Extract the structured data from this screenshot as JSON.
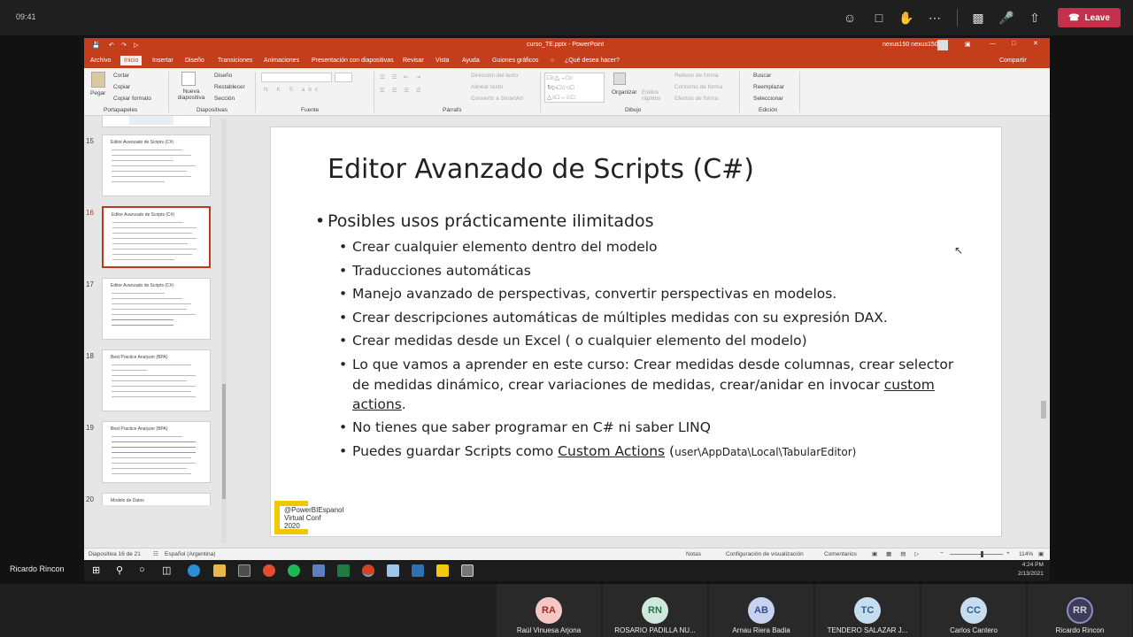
{
  "teams": {
    "time": "09:41",
    "leave_label": "Leave",
    "presenter_name": "Ricardo Rincon"
  },
  "ppt": {
    "window_title": "curso_TE.pptx - PowerPoint",
    "user": "nexus150 nexus150",
    "tabs": [
      "Archivo",
      "Inicio",
      "Insertar",
      "Diseño",
      "Transiciones",
      "Animaciones",
      "Presentación con diapositivas",
      "Revisar",
      "Vista",
      "Ayuda",
      "Guiones gráficos"
    ],
    "tell_me": "¿Qué desea hacer?",
    "share": "Compartir",
    "ribbon": {
      "pegar": "Pegar",
      "cortar": "Cortar",
      "copiar": "Copiar",
      "copiar_formato": "Copiar formato",
      "portapapeles": "Portapapeles",
      "nueva_diapositiva": "Nueva diapositiva",
      "diseno": "Diseño",
      "restablecer": "Restablecer",
      "seccion": "Sección",
      "diapositivas": "Diapositivas",
      "fuente": "Fuente",
      "direccion_texto": "Dirección del texto",
      "alinear_texto": "Alinear texto",
      "convertir_smartart": "Convertir a SmartArt",
      "parrafo": "Párrafo",
      "organizar": "Organizar",
      "estilos_rapidos": "Estilos rápidos",
      "relleno_forma": "Relleno de forma",
      "contorno_forma": "Contorno de forma",
      "efectos_forma": "Efectos de forma",
      "dibujo": "Dibujo",
      "buscar": "Buscar",
      "reemplazar": "Reemplazar",
      "seleccionar": "Seleccionar",
      "edicion": "Edición"
    },
    "thumbnails": [
      {
        "num": "15",
        "title": "Editor Avanzado de Scripts (C#)"
      },
      {
        "num": "16",
        "title": "Editor Avanzado de Scripts (C#)"
      },
      {
        "num": "17",
        "title": "Editor Avanzado de Scripts (C#)"
      },
      {
        "num": "18",
        "title": "Best Practice Analyzer (BPA)"
      },
      {
        "num": "19",
        "title": "Best Practice Analyzer (BPA)"
      },
      {
        "num": "20",
        "title": "Modelo de Datos"
      }
    ],
    "slide": {
      "title": "Editor Avanzado de Scripts (C#)",
      "bullet_main": "Posibles usos prácticamente ilimitados",
      "bullets": [
        "Crear cualquier elemento dentro del modelo",
        "Traducciones automáticas",
        "Manejo avanzado de perspectivas, convertir perspectivas en modelos.",
        "Crear descripciones automáticas de múltiples medidas con su expresión DAX.",
        "Crear medidas desde un Excel ( o cualquier elemento del modelo)",
        "No tienes que saber programar en C# ni saber LINQ"
      ],
      "bullet_long_a": "Lo que vamos a aprender en este curso: Crear medidas desde columnas, crear selector de medidas dinámico, crear variaciones de medidas, crear/anidar en invocar ",
      "bullet_long_link": "custom actions",
      "bullet_long_end": ".",
      "bullet_last_a": "Puedes guardar Scripts como ",
      "bullet_last_link": "Custom Actions",
      "bullet_last_b": " (",
      "bullet_last_path": "user\\AppData\\Local\\TabularEditor",
      "bullet_last_c": ")",
      "conf_line1": "@PowerBIEspanol",
      "conf_line2": "Virtual Conf",
      "conf_line3": "2020"
    },
    "status": {
      "slide_info": "Diapositiva 16 de 21",
      "language": "Español (Argentina)",
      "notas": "Notas",
      "config": "Configuración de visualización",
      "comentarios": "Comentarios",
      "zoom": "114%"
    }
  },
  "taskbar": {
    "clock_time": "4:24 PM",
    "clock_date": "2/13/2021"
  },
  "participants": [
    {
      "initials": "RA",
      "name": "Raúl Vinuesa Arjona",
      "bg": "#f4c7c3",
      "fg": "#a4262c"
    },
    {
      "initials": "RN",
      "name": "ROSARIO PADILLA NU...",
      "bg": "#cfe8dc",
      "fg": "#2b6e4c"
    },
    {
      "initials": "AB",
      "name": "Arnau Riera Badia",
      "bg": "#c7d2f0",
      "fg": "#3a4b8c"
    },
    {
      "initials": "TC",
      "name": "TENDERO SALAZAR J...",
      "bg": "#c6dcef",
      "fg": "#2c5f8a"
    },
    {
      "initials": "CC",
      "name": "Carlos Cantero",
      "bg": "#c6dcef",
      "fg": "#2c5f8a"
    },
    {
      "initials": "RR",
      "name": "Ricardo Rincon",
      "bg": "#3d3d55",
      "fg": "#d0d0e8"
    }
  ]
}
